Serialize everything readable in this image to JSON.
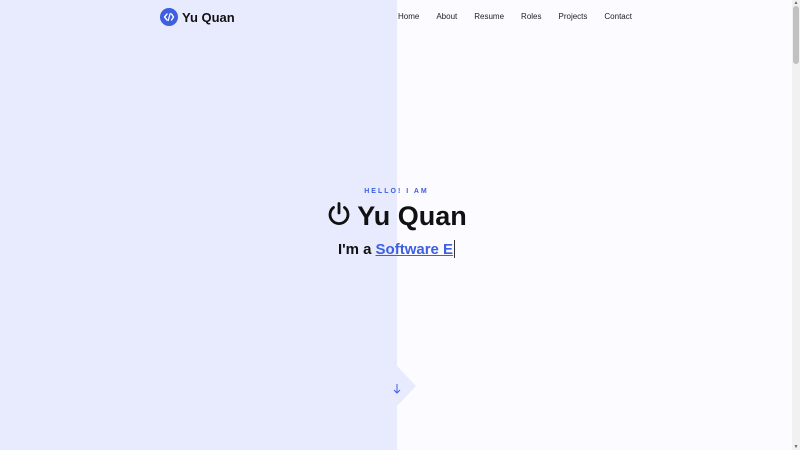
{
  "brand": {
    "name": "Yu Quan"
  },
  "nav": {
    "items": [
      {
        "label": "Home"
      },
      {
        "label": "About"
      },
      {
        "label": "Resume"
      },
      {
        "label": "Roles"
      },
      {
        "label": "Projects"
      },
      {
        "label": "Contact"
      }
    ]
  },
  "hero": {
    "greeting": "HELLO! I AM",
    "name": "Yu Quan",
    "role_prefix": "I'm a",
    "role_typed": "Software E"
  },
  "icons": {
    "logo": "code-slash-icon",
    "name": "power-icon",
    "scroll": "arrow-down-icon"
  },
  "colors": {
    "accent": "#3d5fe0",
    "left_panel": "#e8ebfd",
    "page_bg": "#fcfbff",
    "text": "#111111"
  }
}
